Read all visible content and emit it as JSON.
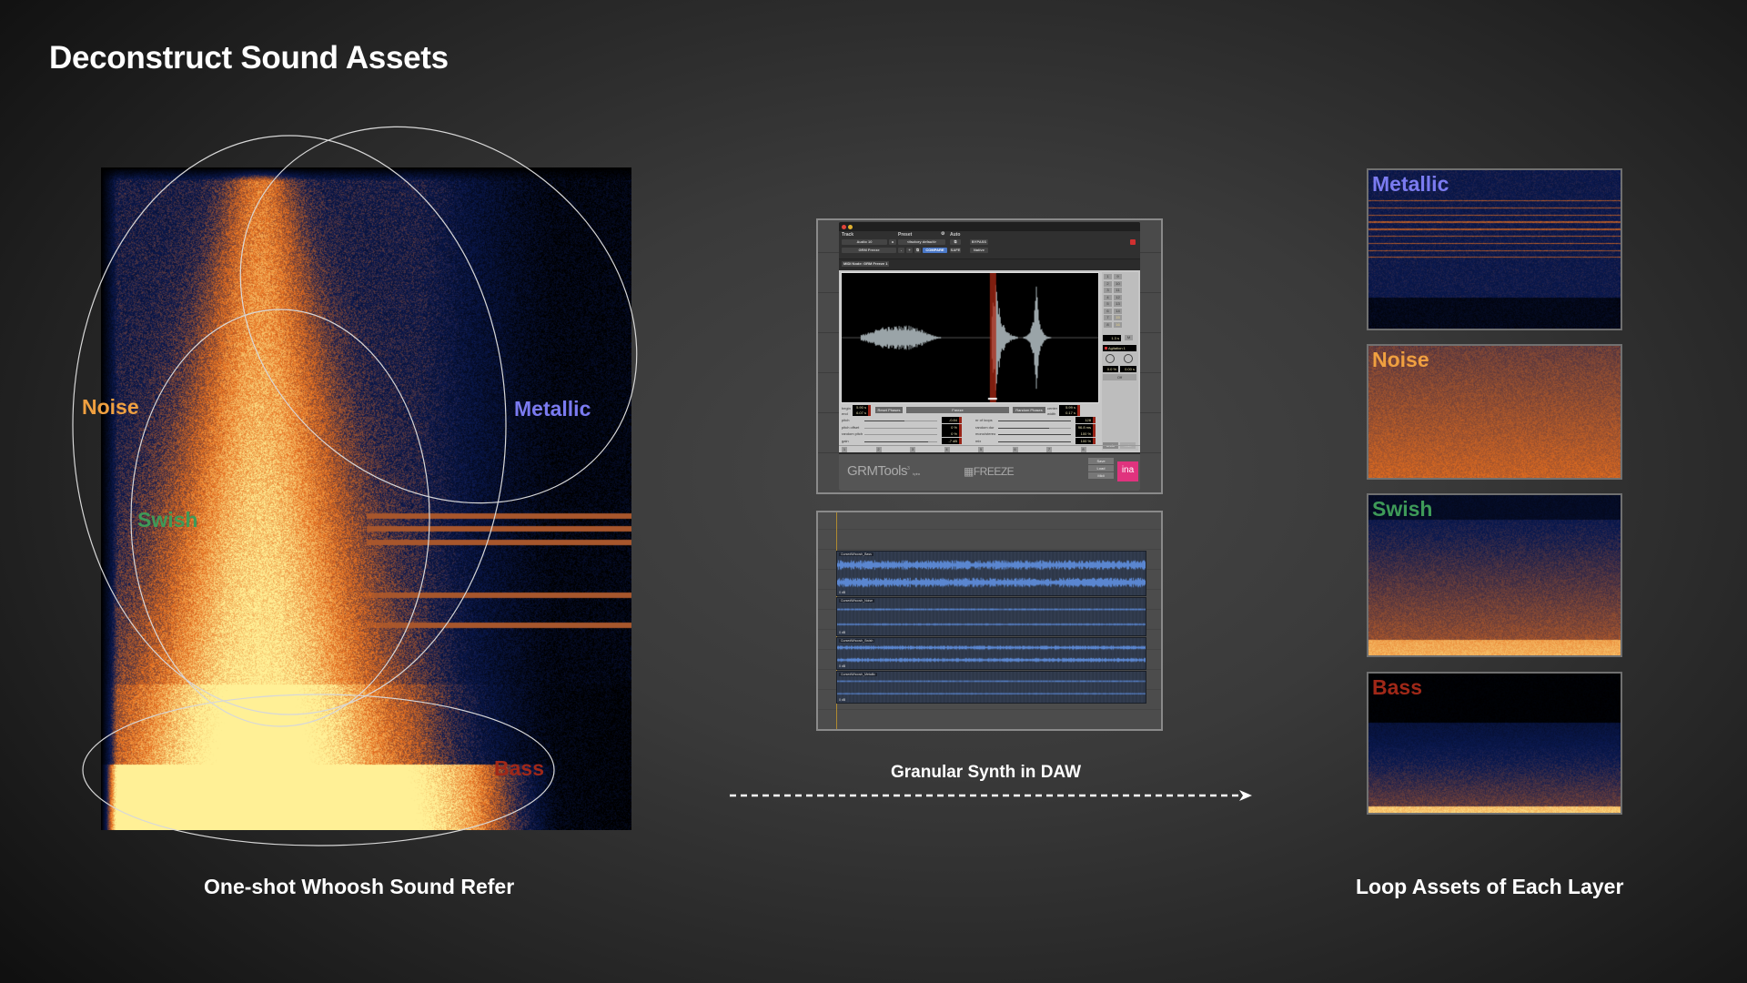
{
  "title": "Deconstruct Sound Assets",
  "captions": {
    "source": "One-shot Whoosh Sound Refer",
    "process": "Granular Synth in DAW",
    "result": "Loop Assets of Each Layer"
  },
  "colors": {
    "noise": "#f0a040",
    "metallic": "#7b7bf0",
    "swish": "#3e9a58",
    "bass": "#a02818",
    "ellipse_stroke": "#d8d8d8"
  },
  "spectrogram_layers": [
    {
      "id": "noise",
      "label": "Noise"
    },
    {
      "id": "metallic",
      "label": "Metallic"
    },
    {
      "id": "swish",
      "label": "Swish"
    },
    {
      "id": "bass",
      "label": "Bass"
    }
  ],
  "plugin": {
    "header": {
      "track_label": "Track",
      "preset_label": "Preset",
      "auto_label": "Auto",
      "track_name": "Audio 10",
      "track_channel": "a",
      "insert_name": "GRM Freeze",
      "preset_name": "<factory default>",
      "compare": "COMPARE",
      "bypass": "BYPASS",
      "safe": "SAFE",
      "native": "Native",
      "minus": "-",
      "plus": "+",
      "midi_node": "MIDI Node: GRM Freeze 1"
    },
    "numpad": [
      "1",
      "2",
      "3",
      "4",
      "5",
      "6",
      "7",
      "8",
      "9",
      "10",
      "11",
      "12",
      "13",
      "14",
      "15",
      "16"
    ],
    "numpad_highlight": [
      "15",
      "16"
    ],
    "time_readout": "1.3 s",
    "m_label": "M",
    "agitation_label": "Agitation 1",
    "agitation_values": [
      "0.0 %",
      "0.00 s"
    ],
    "off_label": "Off",
    "undo": "undo",
    "redo": "redo",
    "begin_label": "begin",
    "end_label": "end",
    "begin_value": "5.90 s",
    "end_value": "6.07 s",
    "reset_phases": "Reset Phases",
    "freeze": "Freeze",
    "random_phases": "Random Phases",
    "center_label": "center",
    "width_label": "width",
    "center_value": "5.99 s",
    "width_value": "0.17 s",
    "left_params": [
      {
        "label": "pitch",
        "value": "-0.84",
        "fill": 0.55
      },
      {
        "label": "pitch offset",
        "value": "0 %",
        "fill": 0.0
      },
      {
        "label": "random pitch",
        "value": "0 %",
        "fill": 0.0
      },
      {
        "label": "gain",
        "value": "-7 dB",
        "fill": 0.88
      }
    ],
    "right_params": [
      {
        "label": "nr of loops",
        "value": "128",
        "fill": 1.0
      },
      {
        "label": "random dur",
        "value": "96.8 ms",
        "fill": 0.7
      },
      {
        "label": "mono/stereo",
        "value": "100 %",
        "fill": 1.0
      },
      {
        "label": "mix",
        "value": "100 %",
        "fill": 1.0
      }
    ],
    "snapshots": [
      "1",
      "2",
      "3",
      "4",
      "5",
      "6",
      "7",
      "8"
    ],
    "brand": "GRMTools",
    "brand_sup": "3",
    "brand_by": "by ina",
    "product": "FREEZE",
    "save": "Save",
    "load": "Load",
    "midi": "Midi",
    "ina": "ina"
  },
  "daw": {
    "tracks": [
      {
        "name": "CursedWhoosh_Bass",
        "gain": "0 dB",
        "kind": "dense"
      },
      {
        "name": "CursedWhoosh_Noise",
        "gain": "0 dB",
        "kind": "flat"
      },
      {
        "name": "CursedWhoosh_Swish",
        "gain": "0 dB",
        "kind": "medium"
      },
      {
        "name": "CursedWhoosh_Metallic",
        "gain": "0 dB",
        "kind": "thin"
      }
    ]
  },
  "assets": [
    {
      "id": "metallic",
      "label": "Metallic"
    },
    {
      "id": "noise",
      "label": "Noise"
    },
    {
      "id": "swish",
      "label": "Swish"
    },
    {
      "id": "bass",
      "label": "Bass"
    }
  ]
}
